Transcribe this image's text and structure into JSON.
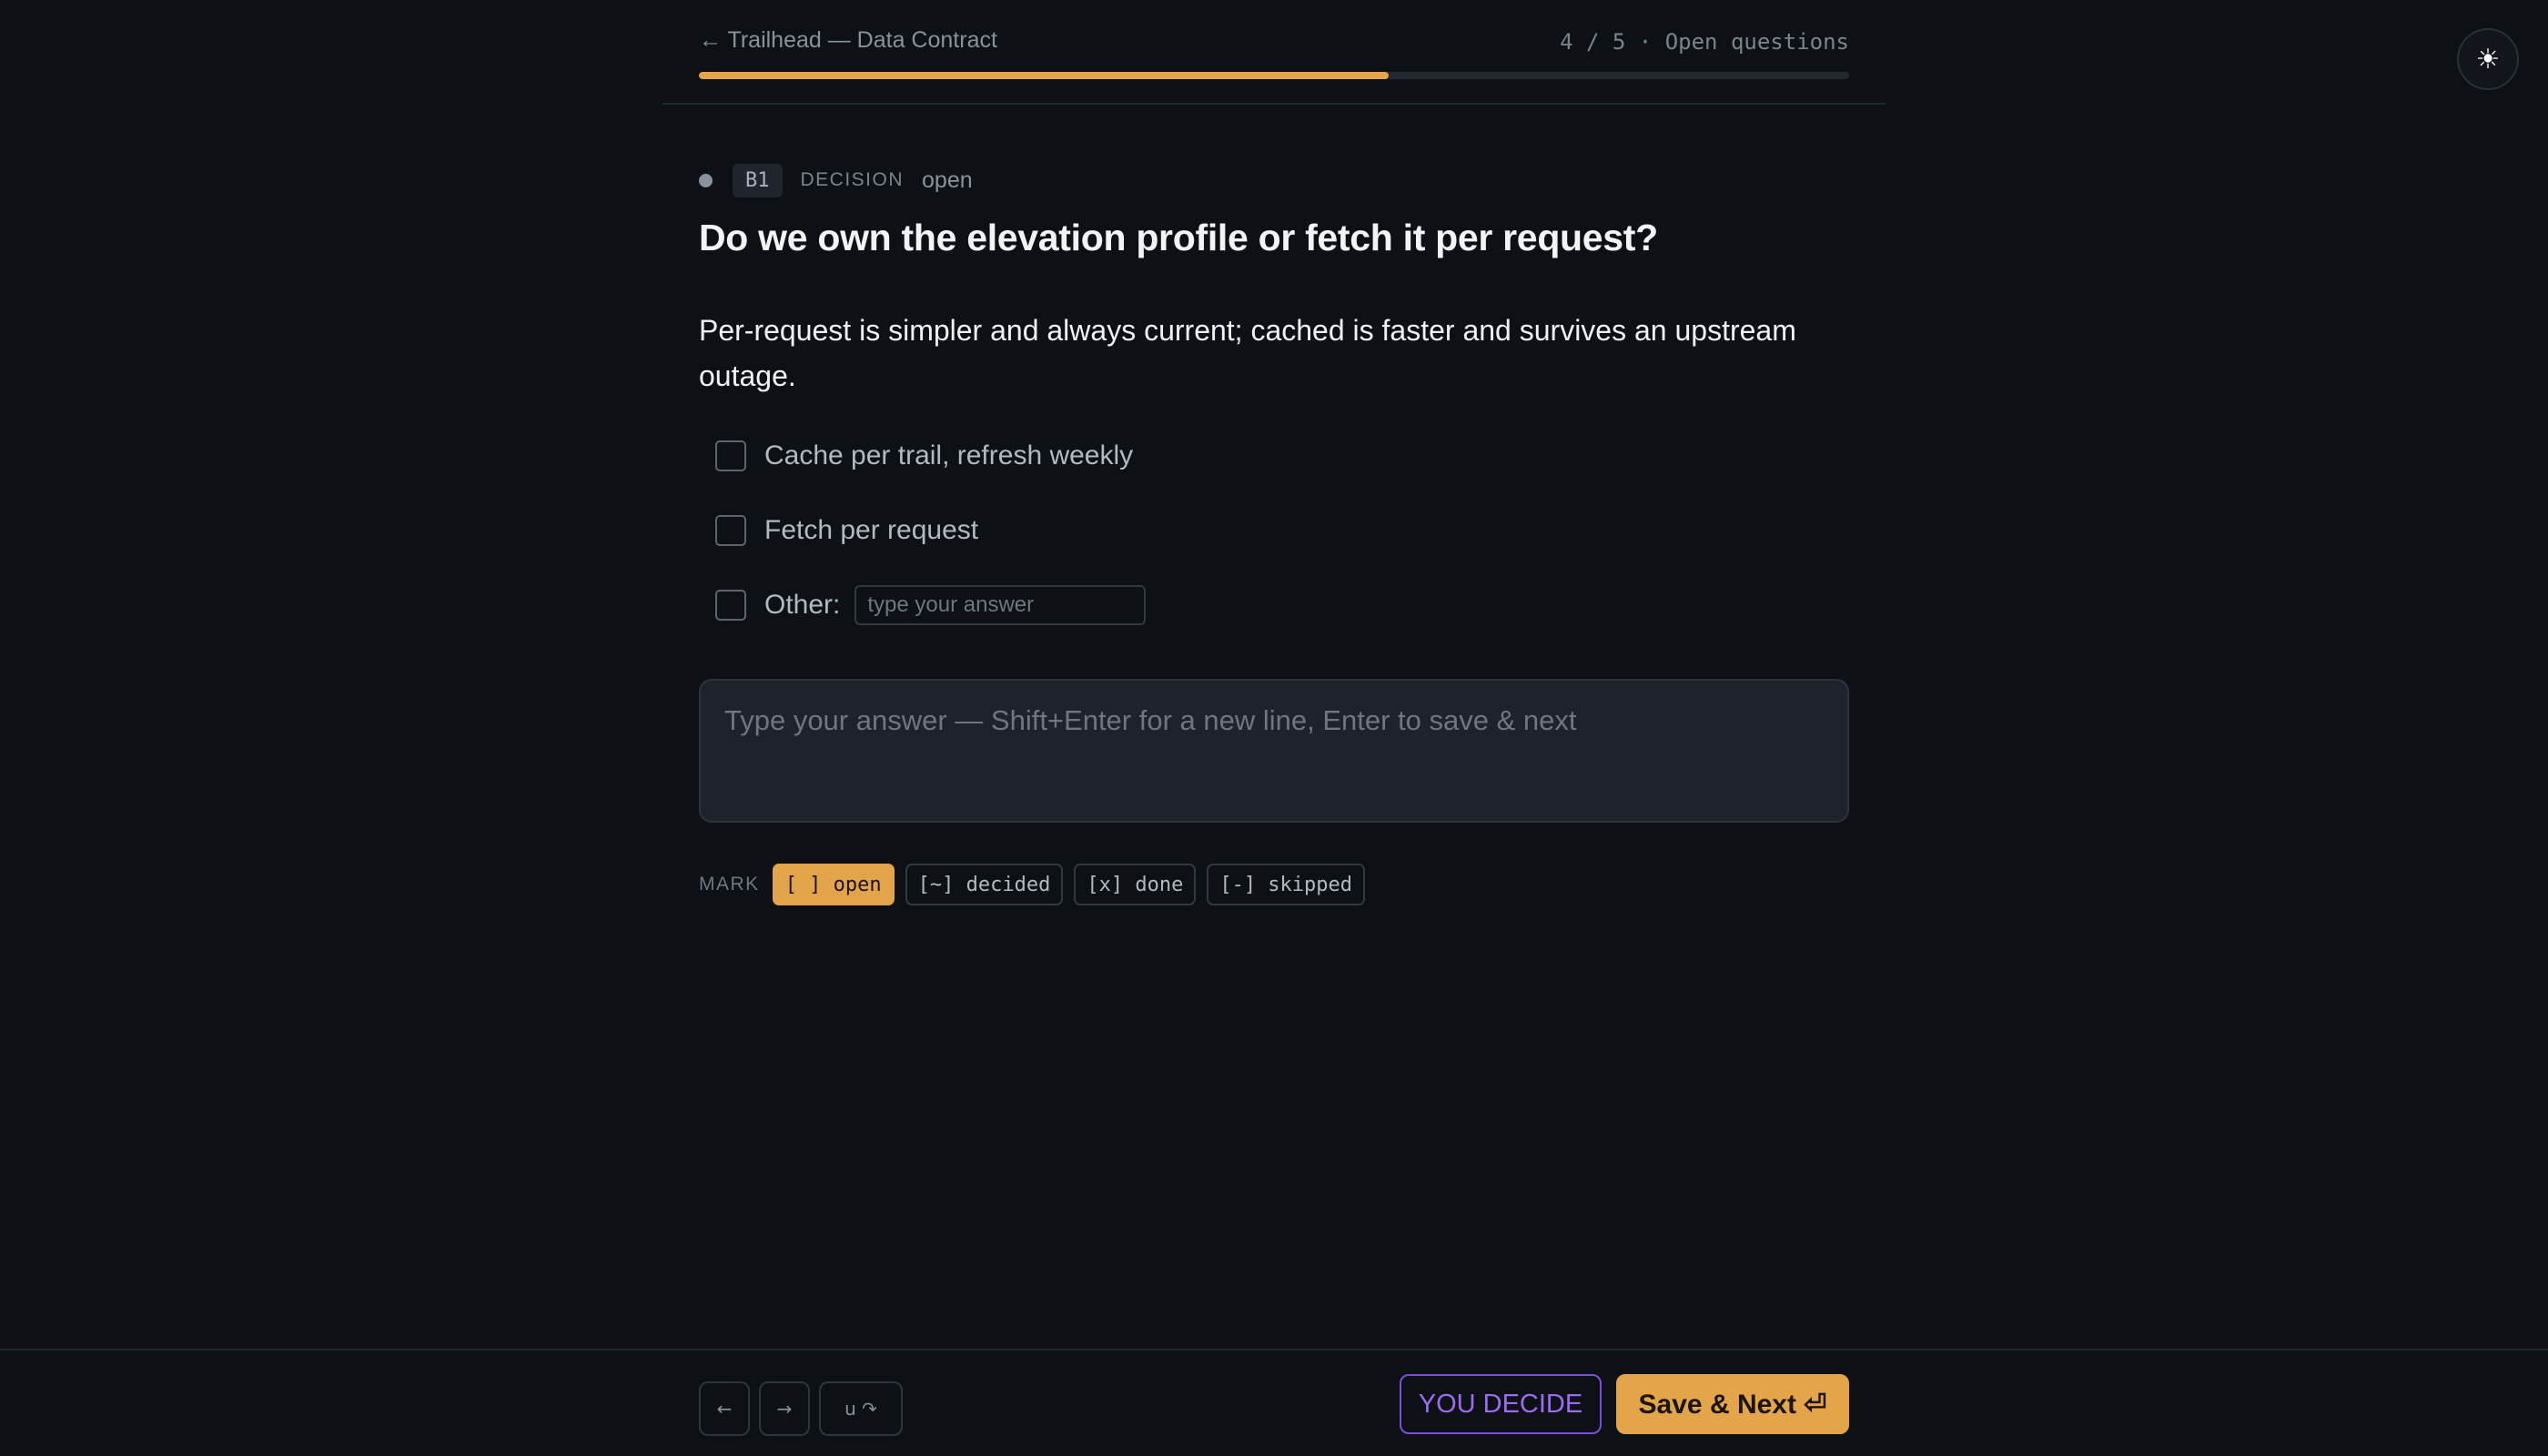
{
  "header": {
    "back_label": "← Trailhead — Data Contract",
    "progress_label": "4 / 5 · Open questions",
    "progress_fraction": 0.6
  },
  "theme_toggle": {
    "icon": "sun-icon",
    "glyph": "☀"
  },
  "question": {
    "id": "B1",
    "kind": "DECISION",
    "state": "open",
    "title": "Do we own the elevation profile or fetch it per request?",
    "description": "Per-request is simpler and always current; cached is faster and survives an upstream outage.",
    "options": [
      {
        "label": "Cache per trail, refresh weekly"
      },
      {
        "label": "Fetch per request"
      }
    ],
    "other": {
      "label": "Other:",
      "placeholder": "type your answer"
    }
  },
  "answer": {
    "placeholder": "Type your answer — Shift+Enter for a new line, Enter to save & next",
    "value": ""
  },
  "mark": {
    "label": "MARK",
    "buttons": [
      {
        "label": "[ ] open",
        "active": true
      },
      {
        "label": "[~] decided",
        "active": false
      },
      {
        "label": "[x] done",
        "active": false
      },
      {
        "label": "[-] skipped",
        "active": false
      }
    ]
  },
  "footer": {
    "prev_glyph": "←",
    "next_glyph": "→",
    "undo_redo_glyph": "u ↷",
    "you_decide_label": "YOU DECIDE",
    "save_next_label": "Save & Next ⏎"
  },
  "colors": {
    "accent": "#e3a44a",
    "you_decide": "#9a6cf2",
    "background": "#0d1015"
  }
}
